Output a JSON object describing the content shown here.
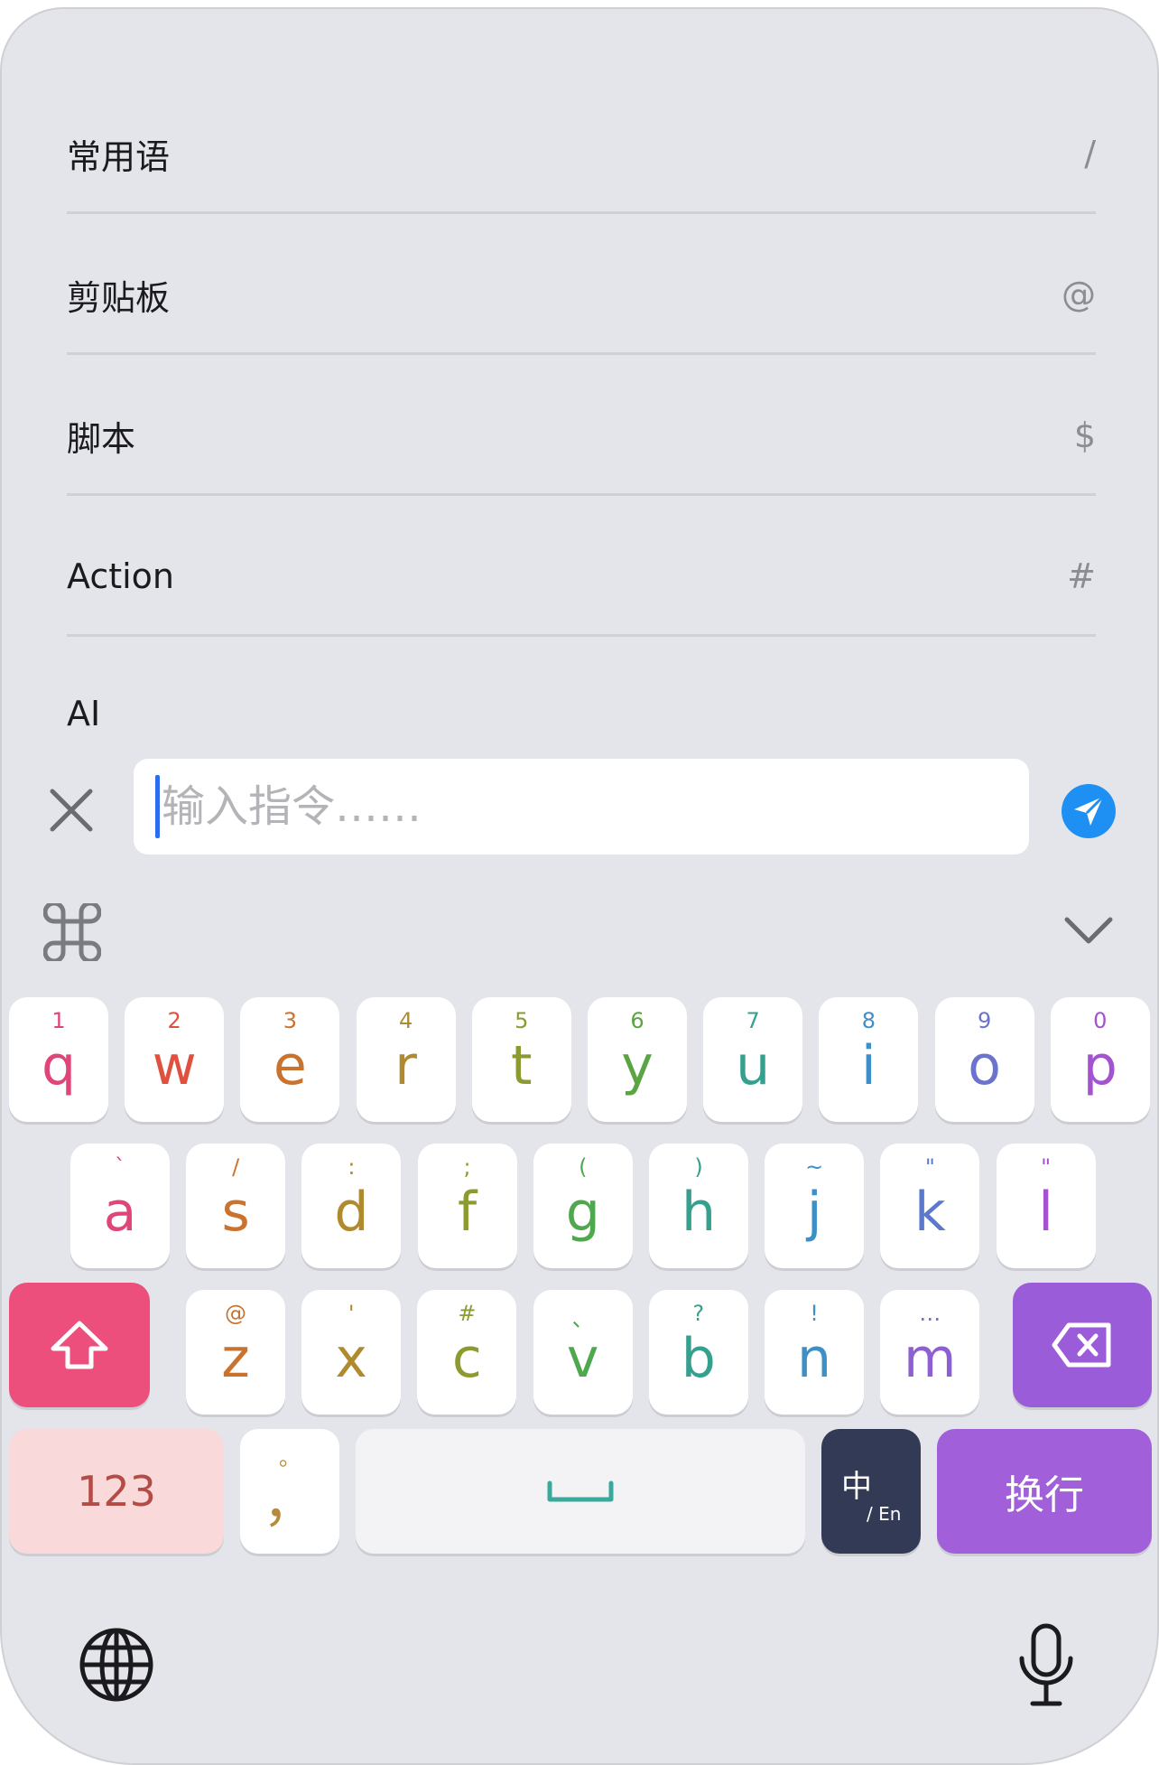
{
  "menu": {
    "items": [
      {
        "label": "常用语",
        "shortcut": "/"
      },
      {
        "label": "剪贴板",
        "shortcut": "@"
      },
      {
        "label": "脚本",
        "shortcut": "$"
      },
      {
        "label": "Action",
        "shortcut": "#"
      },
      {
        "label": "AI",
        "shortcut": ""
      }
    ]
  },
  "command_bar": {
    "input_value": "",
    "input_placeholder": "输入指令……",
    "close_icon": "close-icon",
    "send_icon": "send-icon",
    "send_color": "#1e90f4"
  },
  "toolbar": {
    "command_icon": "command-icon",
    "collapse_icon": "chevron-down-icon"
  },
  "keyboard": {
    "row1": [
      {
        "hint": "1",
        "char": "q",
        "color": "#e0457a"
      },
      {
        "hint": "2",
        "char": "w",
        "color": "#e0503f"
      },
      {
        "hint": "3",
        "char": "e",
        "color": "#c9732f"
      },
      {
        "hint": "4",
        "char": "r",
        "color": "#b08a2e"
      },
      {
        "hint": "5",
        "char": "t",
        "color": "#8c9a30"
      },
      {
        "hint": "6",
        "char": "y",
        "color": "#5aa542"
      },
      {
        "hint": "7",
        "char": "u",
        "color": "#35a08e"
      },
      {
        "hint": "8",
        "char": "i",
        "color": "#3d8fc7"
      },
      {
        "hint": "9",
        "char": "o",
        "color": "#6b73cc"
      },
      {
        "hint": "0",
        "char": "p",
        "color": "#a352d1"
      }
    ],
    "row2": [
      {
        "hint": "`",
        "char": "a",
        "color": "#e0457a"
      },
      {
        "hint": "/",
        "char": "s",
        "color": "#c9732f"
      },
      {
        "hint": ":",
        "char": "d",
        "color": "#b08a2e"
      },
      {
        "hint": ";",
        "char": "f",
        "color": "#8c9a30"
      },
      {
        "hint": "(",
        "char": "g",
        "color": "#4ea84d"
      },
      {
        "hint": ")",
        "char": "h",
        "color": "#35a08e"
      },
      {
        "hint": "~",
        "char": "j",
        "color": "#3d8fc7"
      },
      {
        "hint": "\"",
        "char": "k",
        "color": "#5b78cf"
      },
      {
        "hint": "\"",
        "char": "l",
        "color": "#a352d1"
      }
    ],
    "row3": [
      {
        "hint": "@",
        "char": "z",
        "color": "#c9732f"
      },
      {
        "hint": "'",
        "char": "x",
        "color": "#b08a2e"
      },
      {
        "hint": "#",
        "char": "c",
        "color": "#8c9a30"
      },
      {
        "hint": "、",
        "char": "v",
        "color": "#4ea84d"
      },
      {
        "hint": "?",
        "char": "b",
        "color": "#35a08e"
      },
      {
        "hint": "!",
        "char": "n",
        "color": "#3d8fc7"
      },
      {
        "hint": "…",
        "char": "m",
        "color": "#8e5fd2"
      }
    ],
    "shift_icon": "shift-icon",
    "delete_icon": "backspace-icon",
    "num_label": "123",
    "comma_hint": "。",
    "comma_char": "，",
    "space_icon": "space-icon",
    "lang_main": "中",
    "lang_sub": "/ En",
    "return_label": "换行",
    "globe_icon": "globe-icon",
    "mic_icon": "microphone-icon"
  }
}
